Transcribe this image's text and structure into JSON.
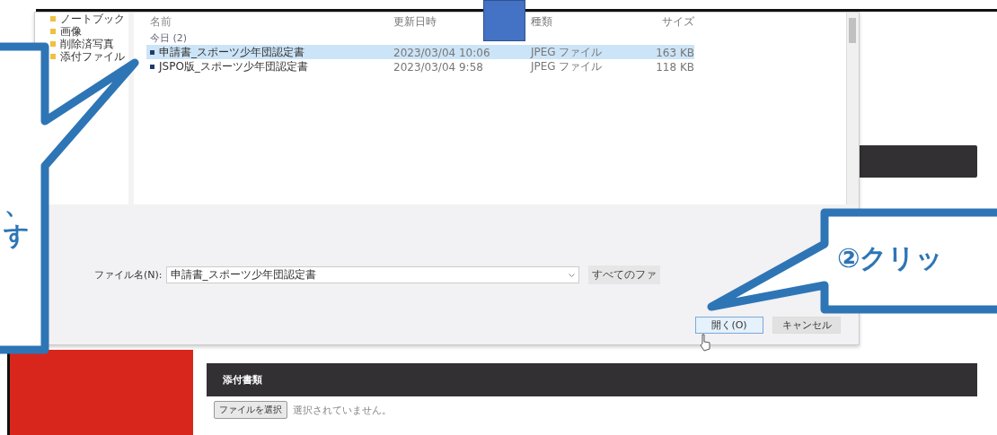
{
  "dialog": {
    "sidebar": {
      "items": [
        {
          "label": "ノートブック",
          "selected": false
        },
        {
          "label": "画像",
          "selected": false
        },
        {
          "label": "削除済写真",
          "selected": false
        },
        {
          "label": "添付ファイル",
          "selected": false
        }
      ]
    },
    "columns": [
      "名前",
      "更新日時",
      "種類",
      "サイズ"
    ],
    "group": "今日 (2)",
    "rows": [
      {
        "name": "申請書_スポーツ少年団認定書",
        "date": "2023/03/04 10:06",
        "type": "JPEG ファイル",
        "size": "163 KB",
        "selected": true
      },
      {
        "name": "JSPO版_スポーツ少年団認定書",
        "date": "2023/03/04 9:58",
        "type": "JPEG ファイル",
        "size": "118 KB",
        "selected": false
      }
    ],
    "filename_label": "ファイル名(N):",
    "filename": "申請書_スポーツ少年団認定書",
    "filter": "すべてのファ",
    "buttons": [
      "開く(O)",
      "キャンセル"
    ]
  },
  "page": {
    "section_title": "添付書類",
    "file_button": "ファイルを選択",
    "file_status": "選択されていません。"
  },
  "callouts": [
    {
      "lines": [
        "、",
        "す"
      ]
    },
    {
      "lines": [
        "②クリッ"
      ]
    }
  ]
}
